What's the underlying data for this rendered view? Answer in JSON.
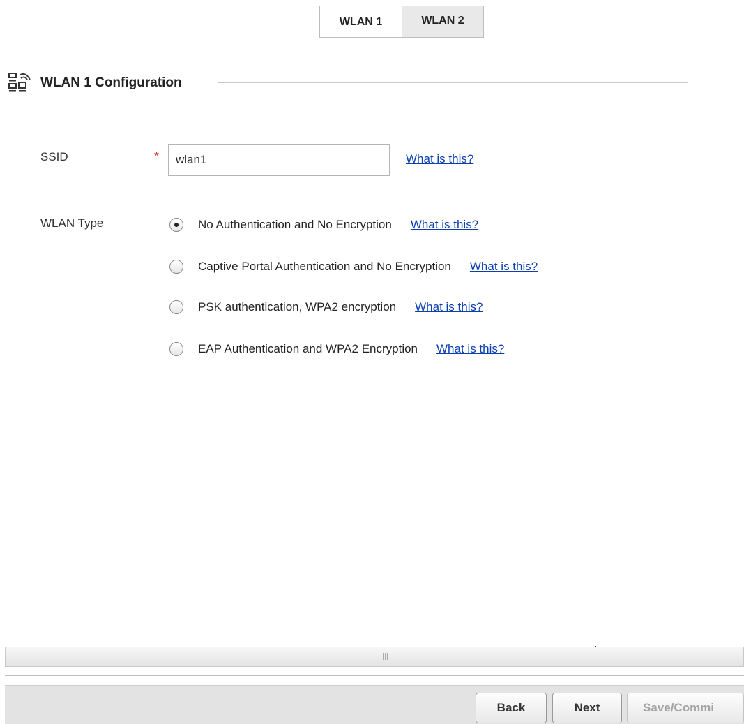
{
  "tabs": [
    {
      "label": "WLAN 1",
      "active": true
    },
    {
      "label": "WLAN 2",
      "active": false
    }
  ],
  "section": {
    "title": "WLAN 1 Configuration",
    "icon": "wlan-config-icon"
  },
  "ssid": {
    "label": "SSID",
    "required_mark": "*",
    "value": "wlan1",
    "help": "What is this?"
  },
  "wlan_type": {
    "label": "WLAN Type",
    "selected_index": 0,
    "options": [
      {
        "label": "No Authentication and No Encryption",
        "help": "What is this?"
      },
      {
        "label": "Captive Portal Authentication and No Encryption",
        "help": "What is this?"
      },
      {
        "label": "PSK authentication, WPA2 encryption",
        "help": "What is this?"
      },
      {
        "label": "EAP Authentication and WPA2 Encryption",
        "help": "What is this?"
      }
    ]
  },
  "footer": {
    "back_label": "Back",
    "next_label": "Next",
    "save_label": "Save/Commi"
  },
  "colors": {
    "link": "#0b3fb0",
    "required": "#e03030",
    "inactive_tab": "#e9e9e9",
    "footer_bg": "#e3e3e3"
  }
}
